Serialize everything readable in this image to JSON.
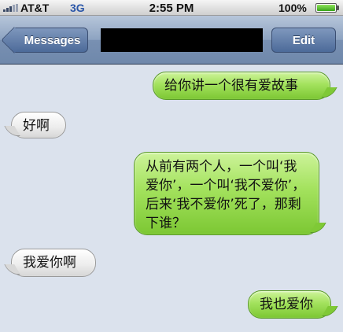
{
  "status_bar": {
    "carrier": "AT&T",
    "network": "3G",
    "time": "2:55 PM",
    "battery_percent": "100%",
    "battery_level": 1.0
  },
  "nav_bar": {
    "back_label": "Messages",
    "edit_label": "Edit"
  },
  "messages": [
    {
      "from": "me",
      "text": "给你讲一个很有爱故事"
    },
    {
      "from": "them",
      "text": "好啊"
    },
    {
      "from": "me",
      "text": "从前有两个人，一个叫‘我爱你’，一个叫‘我不爱你’，后来‘我不爱你’死了，那剩下谁？"
    },
    {
      "from": "them",
      "text": "我爱你啊"
    },
    {
      "from": "me",
      "text": "我也爱你"
    }
  ],
  "colors": {
    "background": "#dbe2ed",
    "sent_bubble": "#a3e25d",
    "received_bubble": "#ececec",
    "nav_bar": "#8da3c1"
  }
}
